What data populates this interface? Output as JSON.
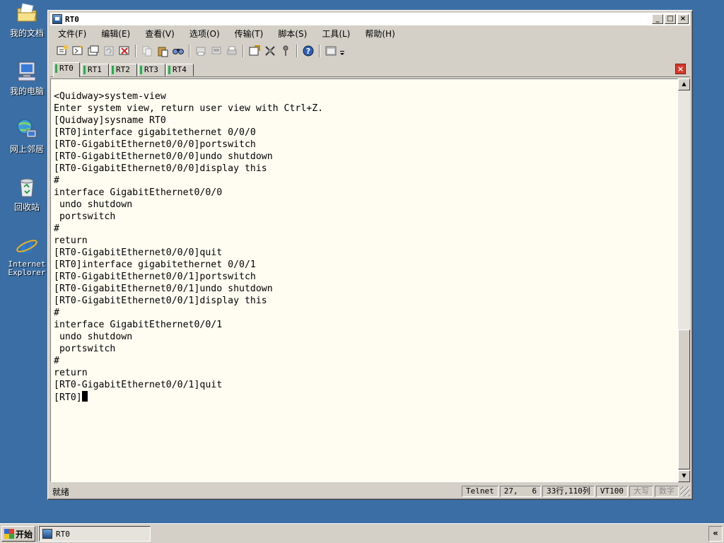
{
  "desktop": {
    "icons": [
      {
        "label": "我的文档",
        "icon": "folder-documents-icon"
      },
      {
        "label": "我的电脑",
        "icon": "computer-icon"
      },
      {
        "label": "网上邻居",
        "icon": "network-icon"
      },
      {
        "label": "回收站",
        "icon": "recycle-bin-icon"
      },
      {
        "label": "Internet Explorer",
        "icon": "internet-explorer-icon"
      }
    ]
  },
  "window": {
    "title": "RT0",
    "controls": {
      "minimize": "_",
      "maximize": "□",
      "close": "×"
    }
  },
  "menu": [
    "文件(F)",
    "编辑(E)",
    "查看(V)",
    "选项(O)",
    "传输(T)",
    "脚本(S)",
    "工具(L)",
    "帮助(H)"
  ],
  "tabs": [
    "RT0",
    "RT1",
    "RT2",
    "RT3",
    "RT4"
  ],
  "active_tab": "RT0",
  "tab_close": "×",
  "terminal": {
    "lines": [
      "<Quidway>system-view",
      "Enter system view, return user view with Ctrl+Z.",
      "[Quidway]sysname RT0",
      "[RT0]interface gigabitethernet 0/0/0",
      "[RT0-GigabitEthernet0/0/0]portswitch",
      "[RT0-GigabitEthernet0/0/0]undo shutdown",
      "[RT0-GigabitEthernet0/0/0]display this",
      "#",
      "interface GigabitEthernet0/0/0",
      " undo shutdown",
      " portswitch",
      "#",
      "return",
      "[RT0-GigabitEthernet0/0/0]quit",
      "[RT0]interface gigabitethernet 0/0/1",
      "[RT0-GigabitEthernet0/0/1]portswitch",
      "[RT0-GigabitEthernet0/0/1]undo shutdown",
      "[RT0-GigabitEthernet0/0/1]display this",
      "#",
      "interface GigabitEthernet0/0/1",
      " undo shutdown",
      " portswitch",
      "#",
      "return",
      "[RT0-GigabitEthernet0/0/1]quit"
    ],
    "prompt": "[RT0]"
  },
  "statusbar": {
    "ready": "就绪",
    "protocol": "Telnet",
    "cursor_pos": "27,   6",
    "size": "33行,110列",
    "terminal_type": "VT100",
    "caps": "大写",
    "num": "数字"
  },
  "taskbar": {
    "start": "开始",
    "task": "RT0",
    "tray_toggle": "«"
  }
}
